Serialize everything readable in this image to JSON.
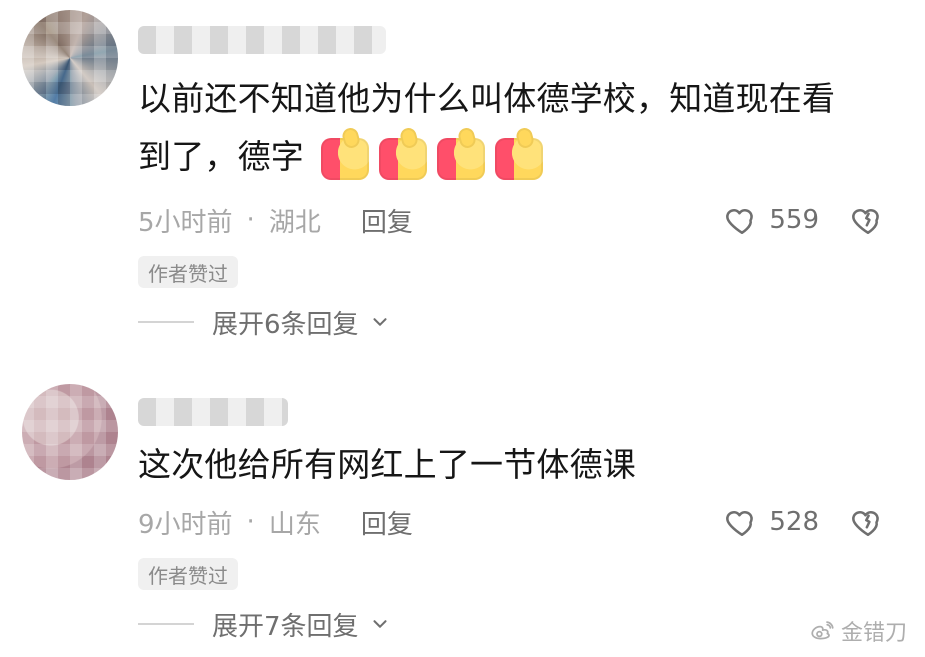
{
  "comments": [
    {
      "text_parts": [
        "以前还不知道他为什么叫体德学校，知道现在看",
        "到了，德字"
      ],
      "time": "5小时前",
      "location": "湖北",
      "reply_label": "回复",
      "likes": "559",
      "badge": "作者赞过",
      "expand_label": "展开6条回复"
    },
    {
      "text_parts": [
        "这次他给所有网红上了一节体德课"
      ],
      "time": "9小时前",
      "location": "山东",
      "reply_label": "回复",
      "likes": "528",
      "badge": "作者赞过",
      "expand_label": "展开7条回复"
    }
  ],
  "separator": "·",
  "watermark": "金错刀",
  "icons": {
    "heart": "heart-icon",
    "broken_heart": "broken-heart-icon",
    "chevron_down": "chevron-down-icon",
    "thumb": "thumbs-up-emoji-icon",
    "weibo": "weibo-logo-icon"
  }
}
